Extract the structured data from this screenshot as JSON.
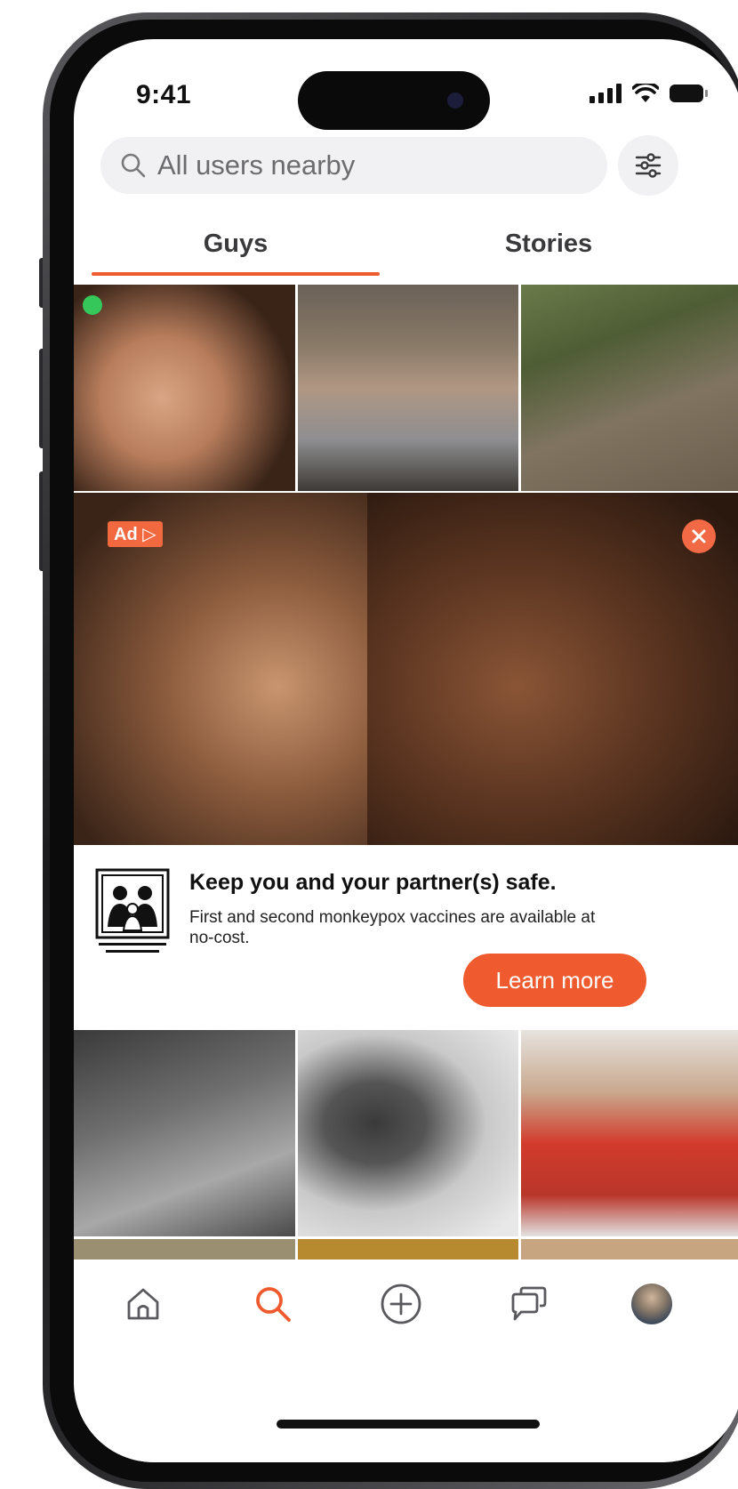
{
  "status_bar": {
    "time": "9:41"
  },
  "search": {
    "placeholder": "All users nearby"
  },
  "tabs": [
    {
      "label": "Guys",
      "active": true
    },
    {
      "label": "Stories",
      "active": false
    }
  ],
  "ad": {
    "badge": "Ad",
    "title": "Keep you and your partner(s) safe.",
    "body": "First and second monkeypox vaccines are available at no-cost.",
    "cta": "Learn more"
  },
  "bottom_nav": [
    {
      "icon": "home-icon"
    },
    {
      "icon": "search-icon",
      "active": true
    },
    {
      "icon": "plus-circle-icon"
    },
    {
      "icon": "chat-icon"
    },
    {
      "icon": "avatar"
    }
  ],
  "colors": {
    "accent": "#f05a2f",
    "online": "#35c759",
    "surface": "#f1f1f3"
  }
}
